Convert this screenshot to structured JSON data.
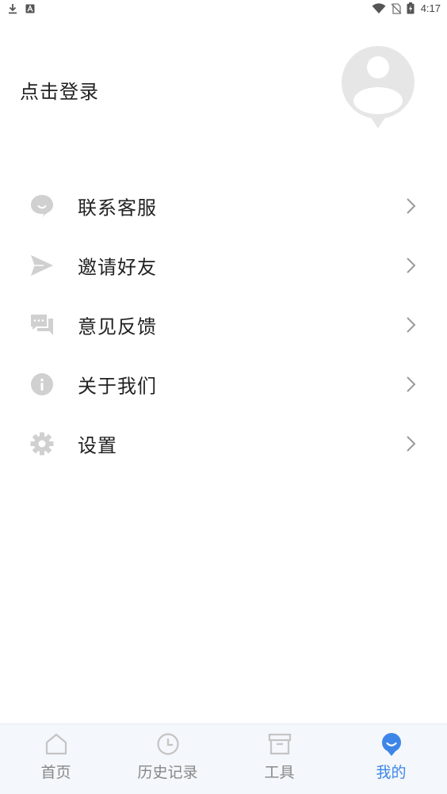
{
  "status_bar": {
    "time": "4:17",
    "left_icons": [
      "download-icon",
      "a-icon"
    ],
    "right_icons": [
      "wifi-icon",
      "no-sim-icon",
      "battery-icon"
    ]
  },
  "header": {
    "login_text": "点击登录"
  },
  "menu": {
    "items": [
      {
        "icon": "chat-bubble-icon",
        "label": "联系客服"
      },
      {
        "icon": "send-icon",
        "label": "邀请好友"
      },
      {
        "icon": "feedback-icon",
        "label": "意见反馈"
      },
      {
        "icon": "info-icon",
        "label": "关于我们"
      },
      {
        "icon": "gear-icon",
        "label": "设置"
      }
    ]
  },
  "bottom_nav": {
    "items": [
      {
        "icon": "home-icon",
        "label": "首页",
        "active": false
      },
      {
        "icon": "clock-icon",
        "label": "历史记录",
        "active": false
      },
      {
        "icon": "archive-icon",
        "label": "工具",
        "active": false
      },
      {
        "icon": "profile-icon",
        "label": "我的",
        "active": true
      }
    ]
  },
  "colors": {
    "accent": "#3d86e8",
    "icon_gray": "#cfcfcf",
    "nav_gray": "#bdbdbd"
  }
}
